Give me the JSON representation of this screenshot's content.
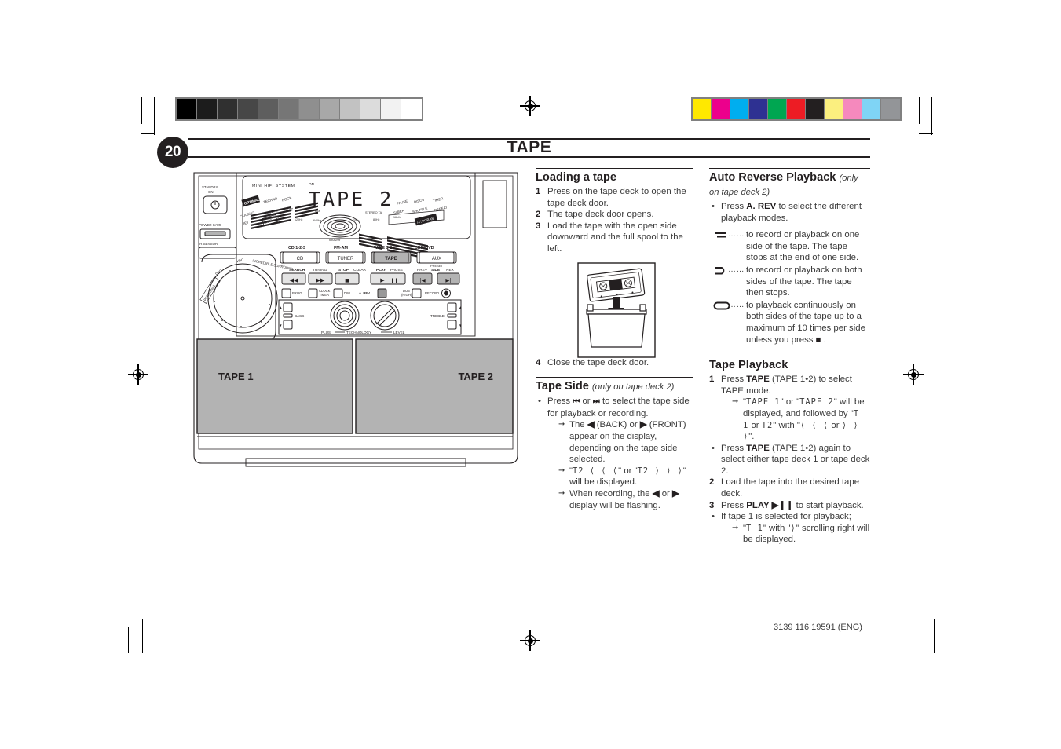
{
  "page": {
    "number": "20",
    "chapter_title": "TAPE",
    "footer_code": "3139 116 19591 (ENG)"
  },
  "calibration": {
    "gray_steps": [
      "#000000",
      "#1c1c1c",
      "#303030",
      "#474747",
      "#5e5e5e",
      "#767676",
      "#8f8f8f",
      "#a8a8a8",
      "#c2c2c2",
      "#dcdcdc",
      "#f2f2f2",
      "#ffffff"
    ],
    "color_steps": [
      "#ffe800",
      "#ec008c",
      "#00aeef",
      "#2e3192",
      "#00a651",
      "#ed1c24",
      "#231f20",
      "#fbef7f",
      "#f589bd",
      "#7fd4f5",
      "#939598"
    ]
  },
  "illustration": {
    "brand_label": "MINI HIFI SYSTEM",
    "display_text": "TAPE 2",
    "display_woofer": "Woofer",
    "left_controls": [
      {
        "label": "STANDBY\nON"
      },
      {
        "label": "POWER SAVE"
      },
      {
        "label": "IR SENSOR"
      }
    ],
    "jog_labels": [
      "PERSONAL DSC",
      "DSC",
      "VDC",
      "INCREDIBLE SURROUND"
    ],
    "source_top_labels": [
      "CD 1-2-3",
      "FM-AM",
      "TAPE 1•2",
      "CDR/DVD"
    ],
    "source_buttons": [
      {
        "label": "CD",
        "active": false
      },
      {
        "label": "TUNER",
        "active": false
      },
      {
        "label": "TAPE",
        "active": true
      },
      {
        "label": "AUX",
        "active": false
      }
    ],
    "transport_top_labels": [
      "SEARCH",
      "TUNING",
      "STOP•CLEAR",
      "PLAY",
      "PAUSE",
      "PREV",
      "PRESET",
      "SIDE",
      "NEXT"
    ],
    "transport_buttons": [
      "◀◀",
      "▶▶",
      "■",
      "▶  ❙❙",
      "⏮",
      "⏭"
    ],
    "small_buttons": [
      {
        "label": "PROG",
        "active": false
      },
      {
        "label": "CLOCK/TIMER",
        "active": false
      },
      {
        "label": "DIM",
        "active": false
      },
      {
        "label": "A. REV",
        "active": true
      },
      {
        "label": "DUB (HIGH)",
        "active": false
      },
      {
        "label": "RECORD",
        "active": false
      }
    ],
    "tone_labels": {
      "bass": "BASS",
      "treble": "TREBLE",
      "knob_caption": "PLUS — TECHNOLOGY — LEVEL"
    },
    "volume_label": "VOLUME",
    "tape_doors": [
      {
        "label": "TAPE 1"
      },
      {
        "label": "TAPE 2"
      }
    ]
  },
  "loading": {
    "heading": "Loading a tape",
    "steps": [
      {
        "num": "1",
        "text": "Press on the tape deck to open the tape deck door."
      },
      {
        "num": "2",
        "text": "The tape deck door opens."
      },
      {
        "num": "3",
        "text": "Load the tape with the open side downward and the full spool to the left."
      }
    ],
    "step4": {
      "num": "4",
      "text": "Close the tape deck door."
    }
  },
  "tape_side": {
    "heading": "Tape Side",
    "heading_sub": "(only on tape deck 2)",
    "bullet_prefix": "Press",
    "bullet_icon_prev": "⏮",
    "bullet_or": "or",
    "bullet_icon_next": "⏭",
    "bullet_rest": "to select the tape side for playback or recording.",
    "arrows": [
      {
        "pre": "The",
        "i1": "◀",
        "m1": "(BACK) or",
        "i2": "▶",
        "m2": "(FRONT) appear on the display, depending on the tape side selected."
      },
      {
        "quoted_a": "T2 ⟨ ⟨ ⟨",
        "quoted_b": "T2 ⟩ ⟩ ⟩",
        "mid": "or",
        "tail": "will be displayed."
      },
      {
        "pre": "When recording, the",
        "i1": "◀",
        "m1": "or",
        "i2": "▶",
        "m2": "display will be flashing."
      }
    ]
  },
  "auto_reverse": {
    "heading": "Auto Reverse Playback",
    "heading_sub": "(only on tape deck 2)",
    "bullet": {
      "pre": "Press",
      "bold": "A. REV",
      "post": "to select the different playback modes."
    },
    "modes": [
      {
        "icon": "one-way",
        "dots": "……",
        "text": "to record or playback on one side of the tape. The tape stops at the end of one side."
      },
      {
        "icon": "half-loop",
        "dots": "……",
        "text": "to record or playback on both sides of the tape. The tape then stops."
      },
      {
        "icon": "full-loop",
        "dots": "……",
        "text": "to playback continuously on both sides of the tape up to a maximum of 10 times per side unless you press"
      }
    ],
    "stop_glyph": "■"
  },
  "tape_playback": {
    "heading": "Tape Playback",
    "items": [
      {
        "type": "num",
        "num": "1",
        "pre": "Press",
        "bold": "TAPE",
        "post": "(TAPE 1•2) to select TAPE mode."
      },
      {
        "type": "arrow",
        "text_a": "TAPE 1",
        "text_b": "TAPE 2",
        "mid": "or",
        "tail": "will be displayed,  and followed by",
        "text_c": "T 1",
        "text_d": "T2",
        "tail2": "with",
        "text_e": "⟨ ⟨ ⟨",
        "text_f": "⟩ ⟩ ⟩",
        "or2": "or"
      },
      {
        "type": "bullet",
        "pre": "Press",
        "bold": "TAPE",
        "post": "(TAPE 1•2) again to select either tape deck 1 or tape deck 2."
      },
      {
        "type": "num",
        "num": "2",
        "pre": "",
        "bold": "",
        "post": "Load the tape into the desired tape deck."
      },
      {
        "type": "num",
        "num": "3",
        "pre": "Press",
        "bold": "PLAY ▶❙❙",
        "post": "to start playback."
      },
      {
        "type": "bullet",
        "pre": "",
        "bold": "",
        "post": "If tape 1 is selected for playback;"
      },
      {
        "type": "arrow2",
        "text_a": "T 1",
        "mid": "with",
        "text_b": "⟩",
        "tail": "scrolling right will be displayed."
      }
    ]
  }
}
